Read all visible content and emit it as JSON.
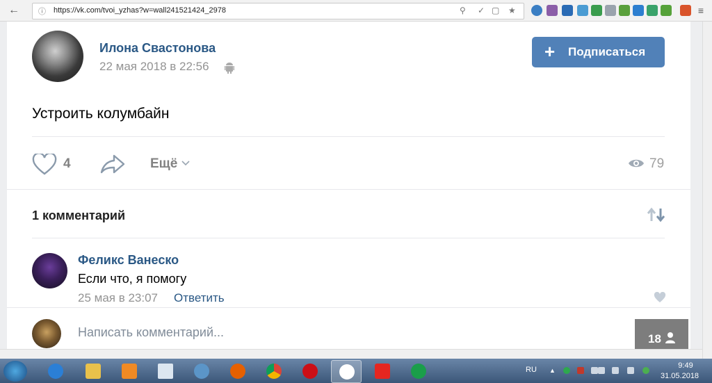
{
  "browser": {
    "url": "https://vk.com/tvoi_yzhas?w=wall241521424_2978"
  },
  "post": {
    "author_name": "Илона Свастонова",
    "date": "22 мая 2018 в 22:56",
    "subscribe_label": "Подписаться",
    "text": "Устроить колумбайн",
    "likes": "4",
    "more_label": "Ещё",
    "views": "79"
  },
  "comments": {
    "title": "1 комментарий",
    "items": [
      {
        "author": "Феликс Ванеско",
        "text": "Если что, я помогу",
        "date": "25 мая в 23:07",
        "reply_label": "Ответить"
      }
    ],
    "input_placeholder": "Написать комментарий..."
  },
  "online_count": "18",
  "taskbar": {
    "lang": "RU",
    "time": "9:49",
    "date": "31.05.2018"
  },
  "colors": {
    "accent": "#5181b8",
    "link": "#2a5885"
  }
}
